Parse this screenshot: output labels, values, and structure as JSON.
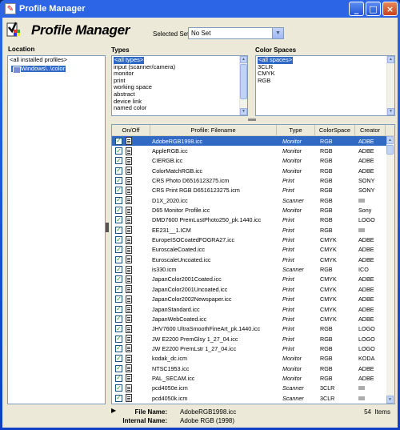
{
  "window": {
    "title": "Profile Manager"
  },
  "header": {
    "app_title": "Profile Manager",
    "selected_set_label": "Selected Set:",
    "selected_set_value": "No Set"
  },
  "location": {
    "label": "Location",
    "items": [
      "<all installed profiles>",
      "Windows\\..\\color"
    ]
  },
  "types": {
    "label": "Types",
    "items": [
      "<all types>",
      "input (scanner/camera)",
      "monitor",
      "print",
      "working space",
      "abstract",
      "device link",
      "named color"
    ]
  },
  "color_spaces": {
    "label": "Color Spaces",
    "items": [
      "<all spaces>",
      "3CLR",
      "CMYK",
      "RGB"
    ]
  },
  "table": {
    "columns": [
      "On/Off",
      "Profile: Filename",
      "Type",
      "ColorSpace",
      "Creator"
    ],
    "rows": [
      {
        "file": "AdobeRGB1998.icc",
        "type": "Monitor",
        "cs": "RGB",
        "creator": "ADBE"
      },
      {
        "file": "AppleRGB.icc",
        "type": "Monitor",
        "cs": "RGB",
        "creator": "ADBE"
      },
      {
        "file": "CIERGB.icc",
        "type": "Monitor",
        "cs": "RGB",
        "creator": "ADBE"
      },
      {
        "file": "ColorMatchRGB.icc",
        "type": "Monitor",
        "cs": "RGB",
        "creator": "ADBE"
      },
      {
        "file": "CRS Photo D6516123275.icm",
        "type": "Print",
        "cs": "RGB",
        "creator": "SONY"
      },
      {
        "file": "CRS Print RGB D6516123275.icm",
        "type": "Print",
        "cs": "RGB",
        "creator": "SONY"
      },
      {
        "file": "D1X_2020.icc",
        "type": "Scanner",
        "cs": "RGB",
        "creator": "IIII"
      },
      {
        "file": "D65 Monitor Profile.icc",
        "type": "Monitor",
        "cs": "RGB",
        "creator": "Sony"
      },
      {
        "file": "DMD7600 PremLustPhoto250_pk.1440.icc",
        "type": "Print",
        "cs": "RGB",
        "creator": "LOGO"
      },
      {
        "file": "EE231__1.ICM",
        "type": "Print",
        "cs": "RGB",
        "creator": "IIII"
      },
      {
        "file": "EuropeISOCoatedFOGRA27.icc",
        "type": "Print",
        "cs": "CMYK",
        "creator": "ADBE"
      },
      {
        "file": "EuroscaleCoated.icc",
        "type": "Print",
        "cs": "CMYK",
        "creator": "ADBE"
      },
      {
        "file": "EuroscaleUncoated.icc",
        "type": "Print",
        "cs": "CMYK",
        "creator": "ADBE"
      },
      {
        "file": "is330.icm",
        "type": "Scanner",
        "cs": "RGB",
        "creator": "ICO"
      },
      {
        "file": "JapanColor2001Coated.icc",
        "type": "Print",
        "cs": "CMYK",
        "creator": "ADBE"
      },
      {
        "file": "JapanColor2001Uncoated.icc",
        "type": "Print",
        "cs": "CMYK",
        "creator": "ADBE"
      },
      {
        "file": "JapanColor2002Newspaper.icc",
        "type": "Print",
        "cs": "CMYK",
        "creator": "ADBE"
      },
      {
        "file": "JapanStandard.icc",
        "type": "Print",
        "cs": "CMYK",
        "creator": "ADBE"
      },
      {
        "file": "JapanWebCoated.icc",
        "type": "Print",
        "cs": "CMYK",
        "creator": "ADBE"
      },
      {
        "file": "JHV7600 UltraSmoothFineArt_pk.1440.icc",
        "type": "Print",
        "cs": "RGB",
        "creator": "LOGO"
      },
      {
        "file": "JW E2200 PremGlsy 1_27_04.icc",
        "type": "Print",
        "cs": "RGB",
        "creator": "LOGO"
      },
      {
        "file": "JW E2200 PremLstr 1_27_04.icc",
        "type": "Print",
        "cs": "RGB",
        "creator": "LOGO"
      },
      {
        "file": "kodak_dc.icm",
        "type": "Monitor",
        "cs": "RGB",
        "creator": "KODA"
      },
      {
        "file": "NTSC1953.icc",
        "type": "Monitor",
        "cs": "RGB",
        "creator": "ADBE"
      },
      {
        "file": "PAL_SECAM.icc",
        "type": "Monitor",
        "cs": "RGB",
        "creator": "ADBE"
      },
      {
        "file": "pcd4050e.icm",
        "type": "Scanner",
        "cs": "3CLR",
        "creator": "IIII"
      },
      {
        "file": "pcd4050k.icm",
        "type": "Scanner",
        "cs": "3CLR",
        "creator": "IIII"
      }
    ]
  },
  "footer": {
    "file_name_label": "File Name:",
    "file_name": "AdobeRGB1998.icc",
    "internal_name_label": "Internal Name:",
    "internal_name": "Adobe RGB (1998)",
    "count": "54",
    "count_unit": "Items"
  }
}
